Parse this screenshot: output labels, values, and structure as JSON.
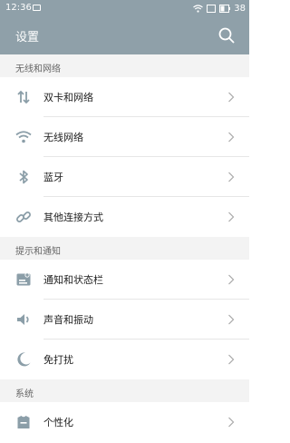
{
  "status_bar": {
    "time": "12:36",
    "battery_level": "38"
  },
  "header": {
    "title": "设置"
  },
  "sections": [
    {
      "title": "无线和网络",
      "items": [
        {
          "label": "双卡和网络",
          "icon": "swap-arrows-icon"
        },
        {
          "label": "无线网络",
          "icon": "wifi-icon"
        },
        {
          "label": "蓝牙",
          "icon": "bluetooth-icon"
        },
        {
          "label": "其他连接方式",
          "icon": "link-icon"
        }
      ]
    },
    {
      "title": "提示和通知",
      "items": [
        {
          "label": "通知和状态栏",
          "icon": "notification-icon"
        },
        {
          "label": "声音和振动",
          "icon": "speaker-icon"
        },
        {
          "label": "免打扰",
          "icon": "moon-icon"
        }
      ]
    },
    {
      "title": "系统",
      "items": [
        {
          "label": "个性化",
          "icon": "shirt-icon"
        }
      ]
    }
  ],
  "colors": {
    "header_bg": "#8fa0a9",
    "icon_color": "#8b9ea8",
    "section_bg": "#f3f3f3"
  }
}
